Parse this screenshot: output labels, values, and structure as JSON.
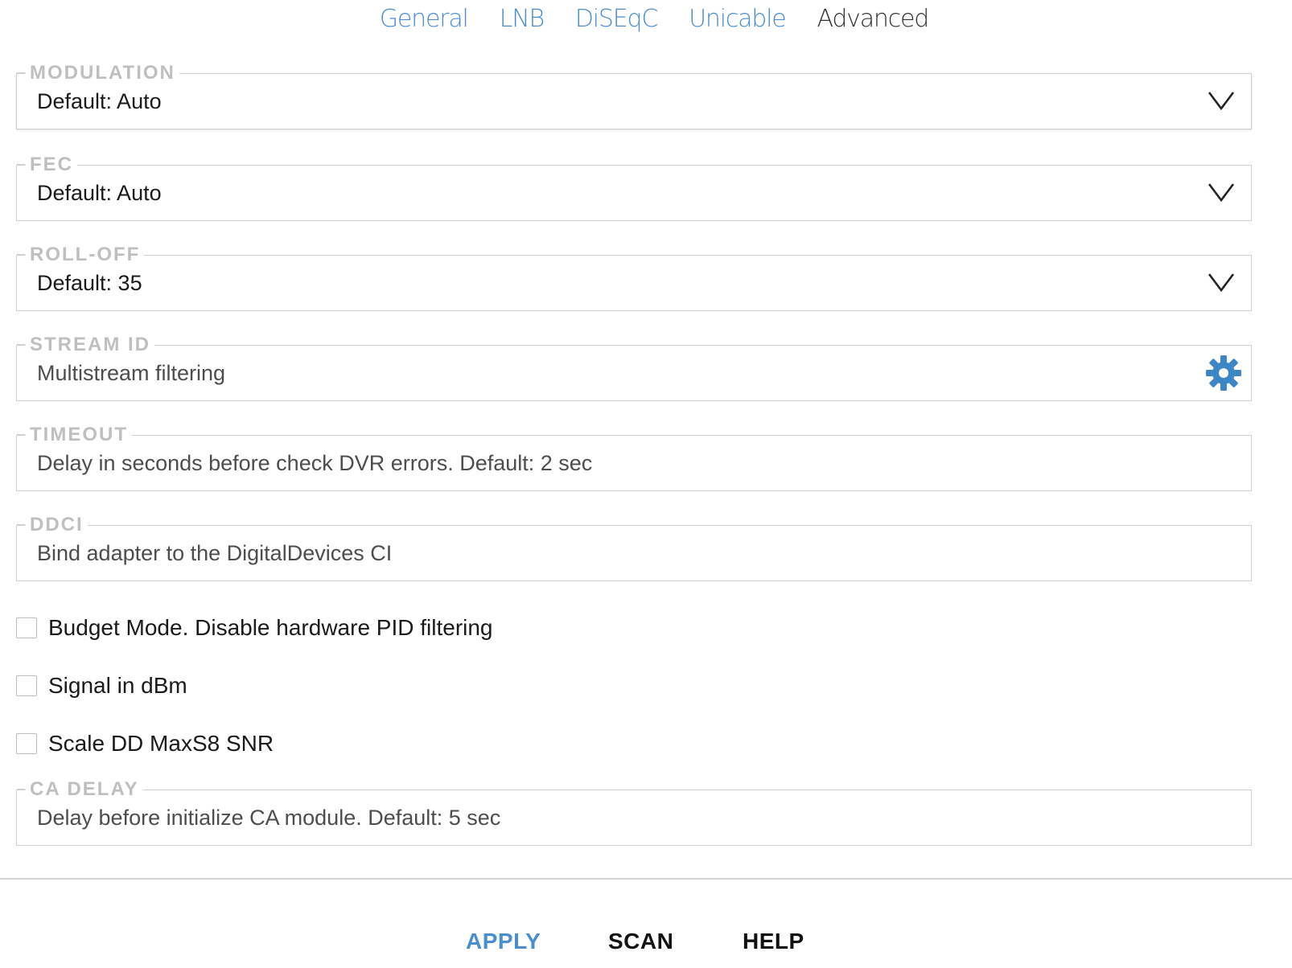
{
  "tabs": [
    {
      "label": "General",
      "active": false
    },
    {
      "label": "LNB",
      "active": false
    },
    {
      "label": "DiSEqC",
      "active": false
    },
    {
      "label": "Unicable",
      "active": false
    },
    {
      "label": "Advanced",
      "active": true
    }
  ],
  "fields": {
    "modulation": {
      "legend": "MODULATION",
      "value": "Default: Auto",
      "icon": "chevron-down-icon"
    },
    "fec": {
      "legend": "FEC",
      "value": "Default: Auto",
      "icon": "chevron-down-icon"
    },
    "rolloff": {
      "legend": "ROLL-OFF",
      "value": "Default: 35",
      "icon": "chevron-down-icon"
    },
    "stream_id": {
      "legend": "STREAM ID",
      "placeholder": "Multistream filtering",
      "icon": "gear-icon"
    },
    "timeout": {
      "legend": "TIMEOUT",
      "placeholder": "Delay in seconds before check DVR errors. Default: 2 sec"
    },
    "ddci": {
      "legend": "DDCI",
      "placeholder": "Bind adapter to the DigitalDevices CI"
    },
    "ca_delay": {
      "legend": "CA DELAY",
      "placeholder": "Delay before initialize CA module. Default: 5 sec"
    }
  },
  "checkboxes": {
    "budget_mode": {
      "label": "Budget Mode. Disable hardware PID filtering",
      "checked": false
    },
    "signal_dbm": {
      "label": "Signal in dBm",
      "checked": false
    },
    "scale_snr": {
      "label": "Scale DD MaxS8 SNR",
      "checked": false
    }
  },
  "footer": {
    "apply": "APPLY",
    "scan": "SCAN",
    "help": "HELP"
  },
  "colors": {
    "accent": "#4a8dd0",
    "legend": "#bfbfbf",
    "border": "#cfcfcf"
  }
}
